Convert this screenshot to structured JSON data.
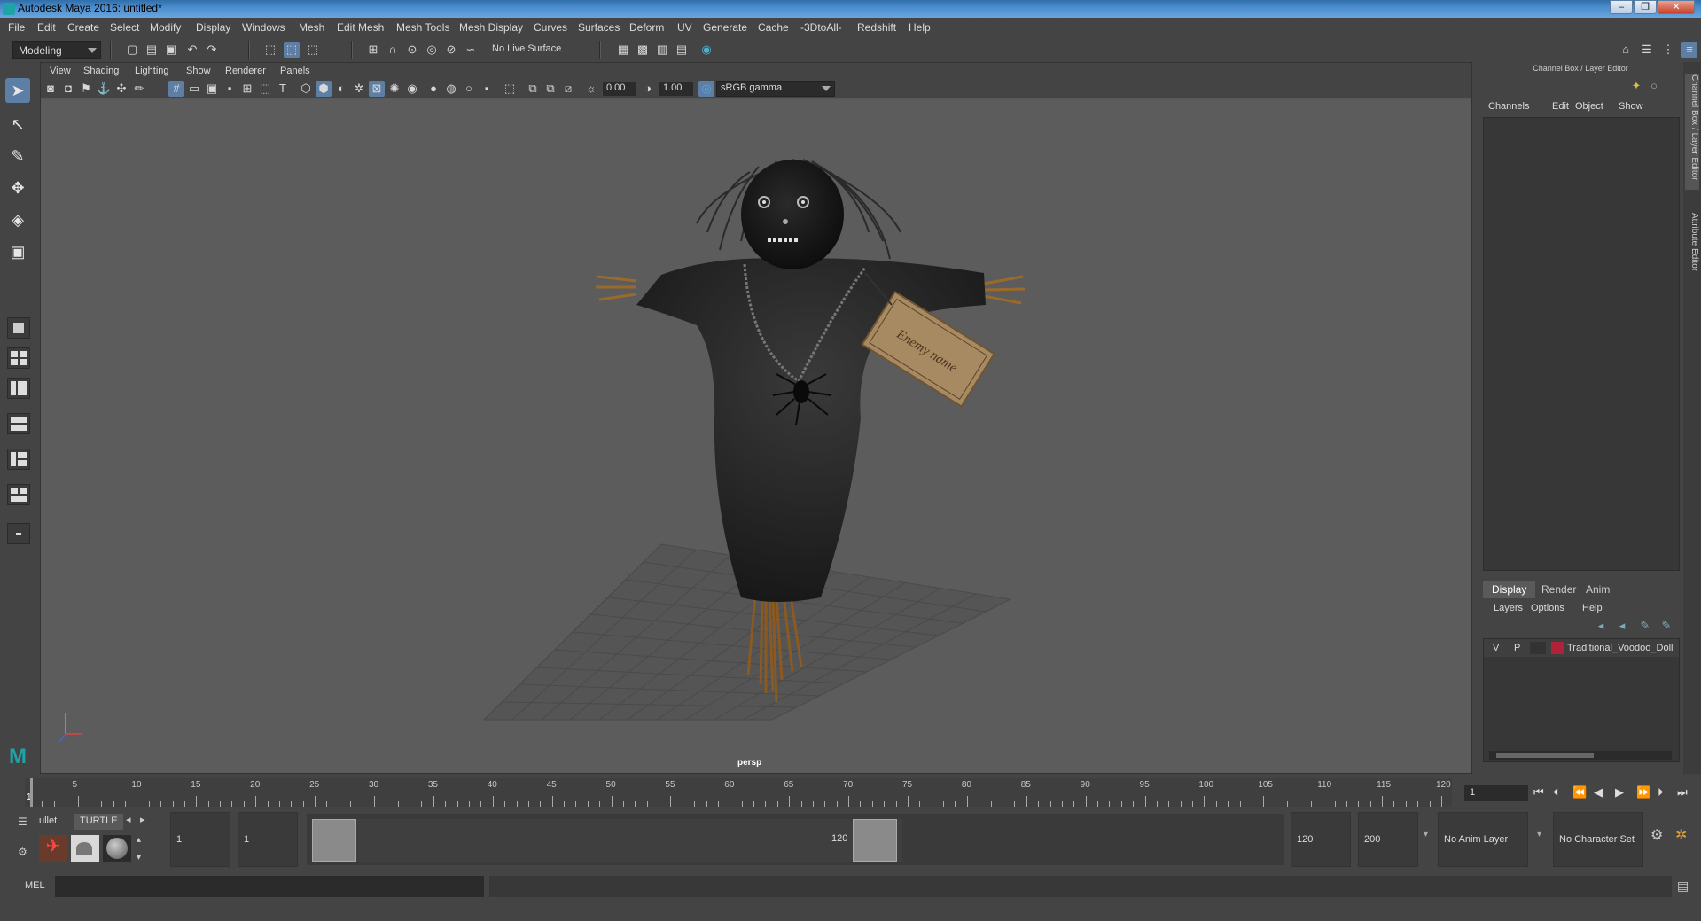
{
  "window": {
    "title": "Autodesk Maya 2016: untitled*"
  },
  "menus": [
    "File",
    "Edit",
    "Create",
    "Select",
    "Modify",
    "Display",
    "Windows",
    "Mesh",
    "Edit Mesh",
    "Mesh Tools",
    "Mesh Display",
    "Curves",
    "Surfaces",
    "Deform",
    "UV",
    "Generate",
    "Cache",
    "-3DtoAll-",
    "Redshift",
    "Help"
  ],
  "statusline": {
    "mode": "Modeling",
    "live_surface": "No Live Surface"
  },
  "viewport": {
    "menus": [
      "View",
      "Shading",
      "Lighting",
      "Show",
      "Renderer",
      "Panels"
    ],
    "exposure": "0.00",
    "gamma": "1.00",
    "colorspace": "sRGB gamma",
    "camera_label": "persp",
    "tag_text": "Enemy name"
  },
  "channel_box": {
    "header": "Channel Box / Layer Editor",
    "menus": [
      "Channels",
      "Edit",
      "Object",
      "Show"
    ],
    "layer_tabs": [
      "Display",
      "Render",
      "Anim"
    ],
    "layer_menus": [
      "Layers",
      "Options",
      "Help"
    ],
    "layer": {
      "v": "V",
      "p": "P",
      "name": "Traditional_Voodoo_Doll",
      "color": "#b0223a"
    },
    "side_tabs": [
      "Channel Box / Layer Editor",
      "Attribute Editor"
    ]
  },
  "timeline": {
    "ticks": [
      "5",
      "10",
      "15",
      "20",
      "25",
      "30",
      "35",
      "40",
      "45",
      "50",
      "55",
      "60",
      "65",
      "70",
      "75",
      "80",
      "85",
      "90",
      "95",
      "100",
      "105",
      "110",
      "115",
      "120"
    ],
    "start_marker": "1",
    "current_frame": "1"
  },
  "range": {
    "shelf_tabs": [
      "ullet",
      "TURTLE"
    ],
    "start_frame": "1",
    "playback_start": "1",
    "range_start": "1",
    "range_end": "120",
    "playback_end": "120",
    "end_frame": "200",
    "anim_layer": "No Anim Layer",
    "character_set": "No Character Set"
  },
  "command_line": {
    "label": "MEL"
  }
}
